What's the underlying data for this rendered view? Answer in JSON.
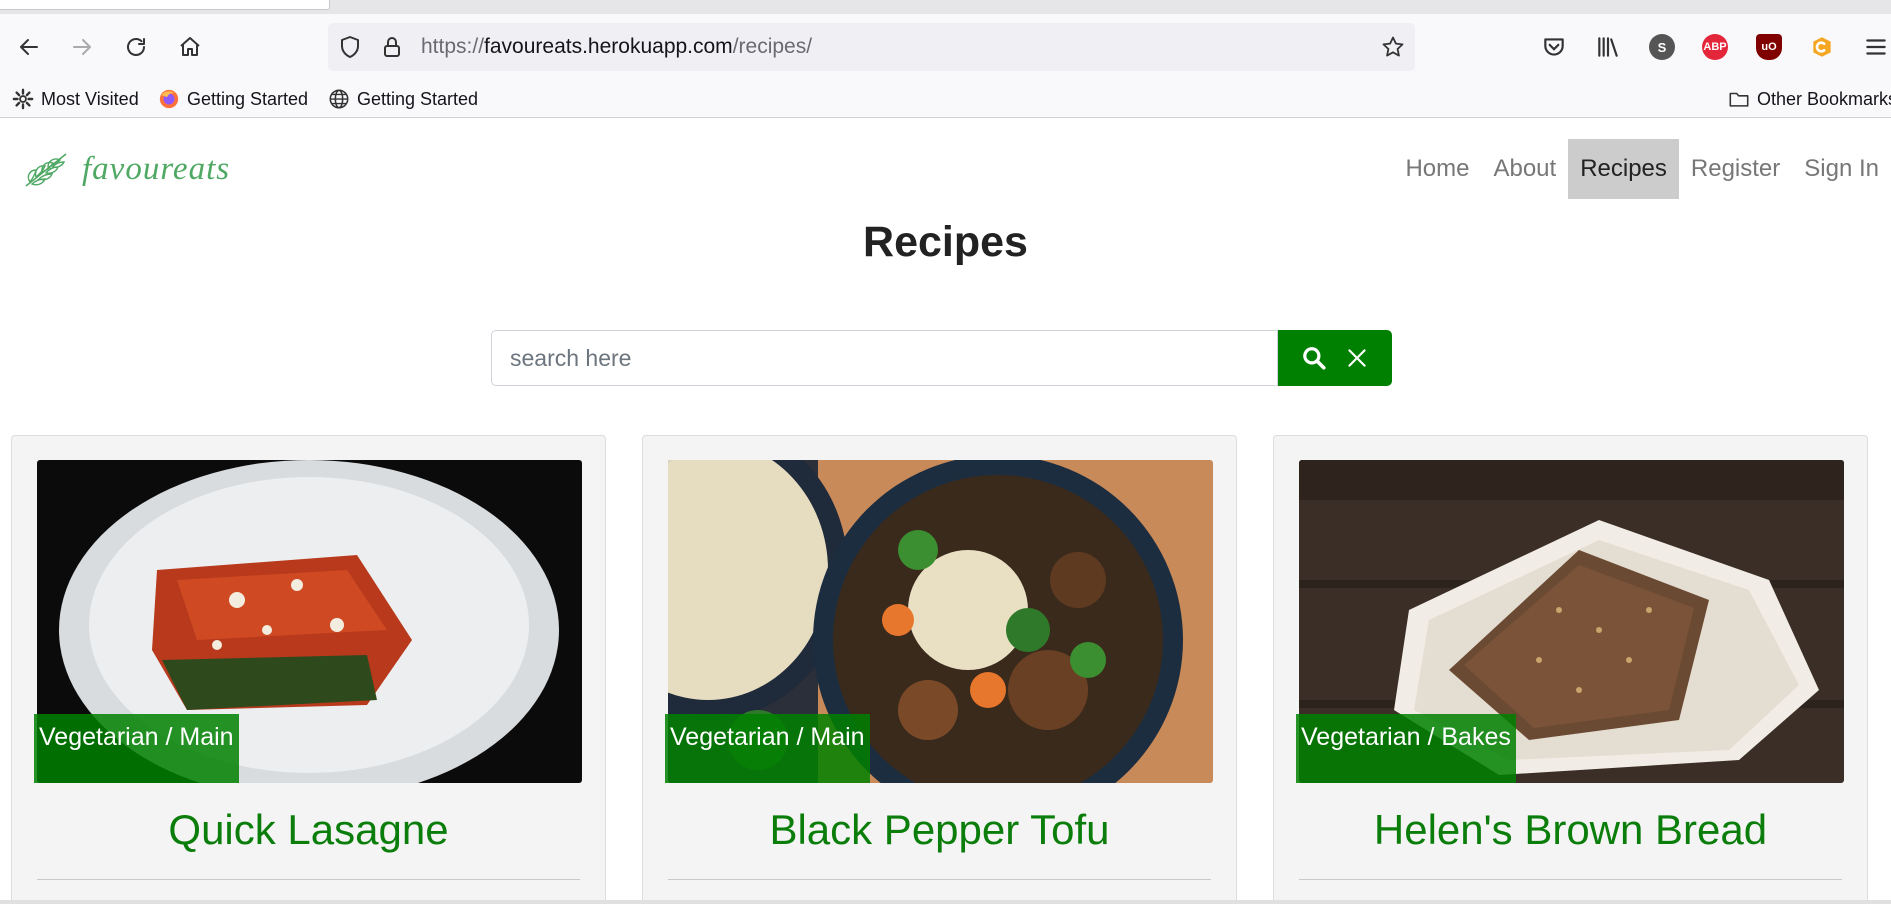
{
  "browser": {
    "url_prefix": "https://",
    "url_host": "favoureats.herokuapp.com",
    "url_path": "/recipes/",
    "bookmarks": [
      {
        "label": "Most Visited",
        "icon": "gear-icon"
      },
      {
        "label": "Getting Started",
        "icon": "firefox-icon"
      },
      {
        "label": "Getting Started",
        "icon": "globe-icon"
      }
    ],
    "other_bookmarks": "Other Bookmarks",
    "extensions": {
      "s_badge": "S",
      "abp_badge": "ABP",
      "ublock_badge": "uO"
    }
  },
  "site": {
    "logo_text": "favoureats",
    "nav": [
      {
        "label": "Home"
      },
      {
        "label": "About"
      },
      {
        "label": "Recipes"
      },
      {
        "label": "Register"
      },
      {
        "label": "Sign In"
      }
    ],
    "active_nav": "Recipes",
    "page_title": "Recipes",
    "search_placeholder": "search here"
  },
  "recipes": [
    {
      "tag": "Vegetarian / Main",
      "title": "Quick Lasagne",
      "image": "lasagne-photo"
    },
    {
      "tag": "Vegetarian / Main",
      "title": "Black Pepper Tofu",
      "image": "tofu-bowl-photo"
    },
    {
      "tag": "Vegetarian / Bakes",
      "title": "Helen's Brown Bread",
      "image": "brown-bread-photo"
    }
  ],
  "colors": {
    "brand_green": "#008000",
    "title_green": "#0a7d0a",
    "logo_green": "#4fa863"
  }
}
